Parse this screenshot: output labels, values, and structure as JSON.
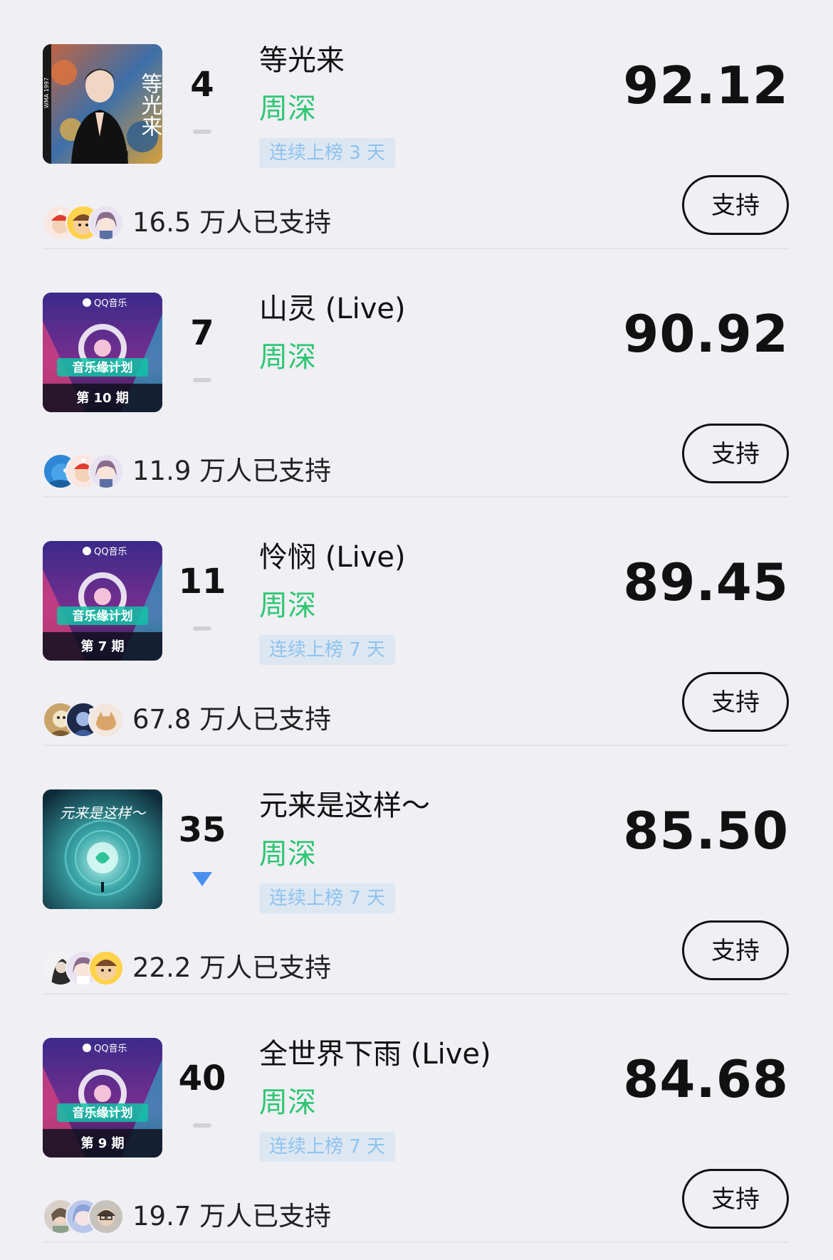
{
  "colors": {
    "background": "#efeff4",
    "artist": "#2fc673",
    "streak_text": "#8ec3ee",
    "streak_bg": "#dde7f2",
    "trend_down": "#4a8ff0"
  },
  "items": [
    {
      "rank": "4",
      "trend": "flat",
      "title": "等光来",
      "artist": "周深",
      "streak": "连续上榜 3 天",
      "score": "92.12",
      "supporters": "16.5 万人已支持",
      "button": "支持",
      "cover": {
        "icon": "album-cover-portrait",
        "text": "等光来",
        "side_text": "WMA 1997"
      }
    },
    {
      "rank": "7",
      "trend": "flat",
      "title": "山灵 (Live)",
      "artist": "周深",
      "streak": "",
      "score": "90.92",
      "supporters": "11.9 万人已支持",
      "button": "支持",
      "cover": {
        "icon": "album-cover-show",
        "brand": "QQ音乐",
        "show": "音乐缘计划",
        "episode": "第 10 期"
      }
    },
    {
      "rank": "11",
      "trend": "flat",
      "title": "怜悯 (Live)",
      "artist": "周深",
      "streak": "连续上榜 7 天",
      "score": "89.45",
      "supporters": "67.8 万人已支持",
      "button": "支持",
      "cover": {
        "icon": "album-cover-show",
        "brand": "QQ音乐",
        "show": "音乐缘计划",
        "episode": "第 7 期"
      }
    },
    {
      "rank": "35",
      "trend": "down",
      "title": "元来是这样～",
      "artist": "周深",
      "streak": "连续上榜 7 天",
      "score": "85.50",
      "supporters": "22.2 万人已支持",
      "button": "支持",
      "cover": {
        "icon": "album-cover-scifi",
        "text": "元来是这样～"
      }
    },
    {
      "rank": "40",
      "trend": "flat",
      "title": "全世界下雨 (Live)",
      "artist": "周深",
      "streak": "连续上榜 7 天",
      "score": "84.68",
      "supporters": "19.7 万人已支持",
      "button": "支持",
      "cover": {
        "icon": "album-cover-show",
        "brand": "QQ音乐",
        "show": "音乐缘计划",
        "episode": "第 9 期"
      }
    }
  ]
}
